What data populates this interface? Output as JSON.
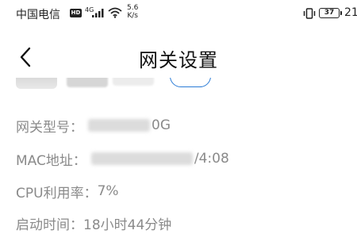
{
  "status_bar": {
    "carrier": "中国电信",
    "hd_badge": "HD",
    "net_type": "4G",
    "speed_value": "5.6",
    "speed_unit": "K/s",
    "battery": "37",
    "time": "21"
  },
  "nav": {
    "title": "网关设置"
  },
  "info": {
    "model_label": "网关型号：",
    "model_value_suffix": "0G",
    "mac_label": "MAC地址：",
    "mac_value_suffix": "/4:08",
    "cpu_label": "CPU利用率：",
    "cpu_value": "7%",
    "uptime_label": "启动时间：",
    "uptime_value": "18小时44分钟"
  }
}
